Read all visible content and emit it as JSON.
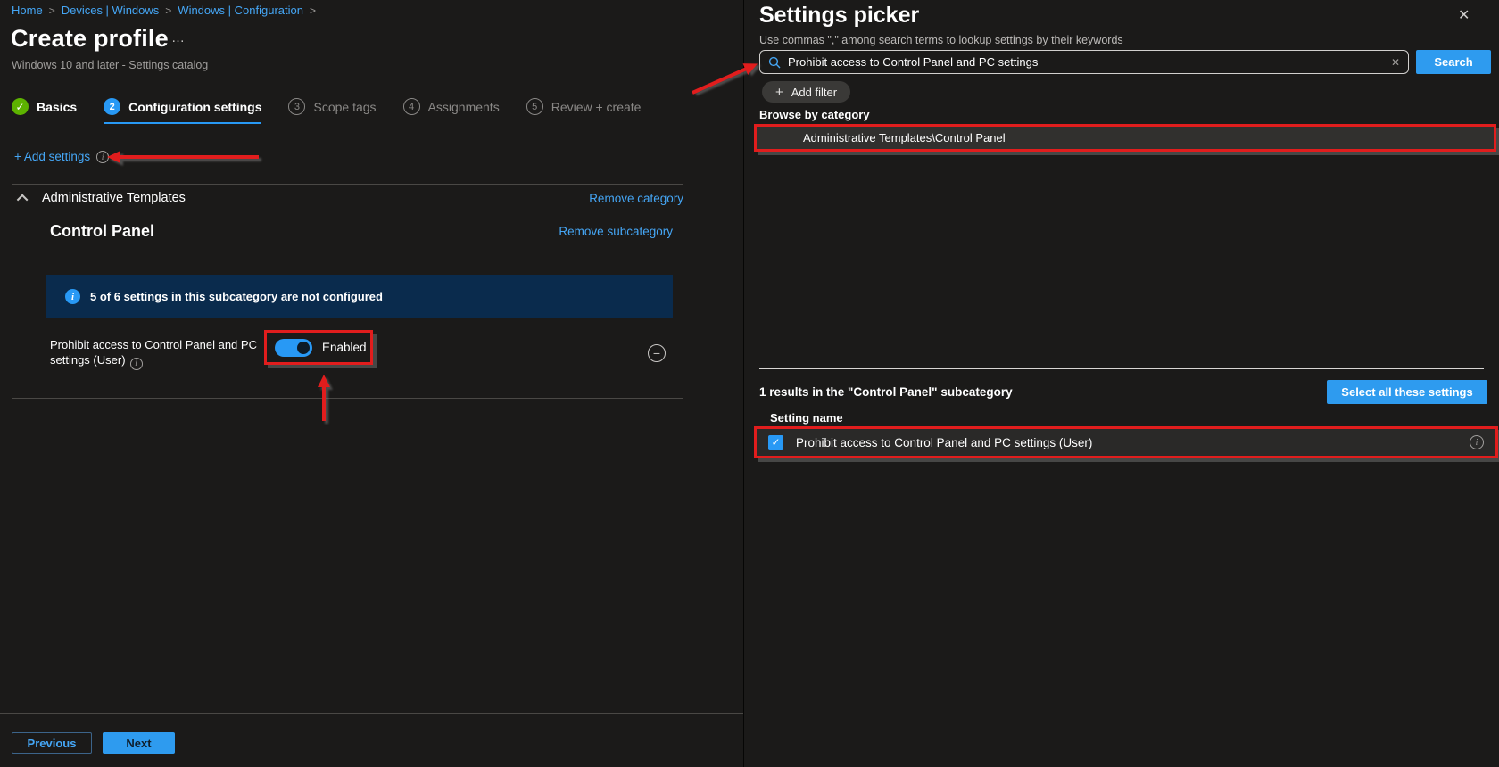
{
  "breadcrumb": {
    "separator": ">",
    "items": [
      {
        "label": "Home"
      },
      {
        "label": "Devices | Windows"
      },
      {
        "label": "Windows | Configuration"
      }
    ]
  },
  "header": {
    "title": "Create profile",
    "menu_dots": "…",
    "subtitle": "Windows 10 and later - Settings catalog"
  },
  "steps": [
    {
      "num": "✓",
      "label": "Basics"
    },
    {
      "num": "2",
      "label": "Configuration settings"
    },
    {
      "num": "3",
      "label": "Scope tags"
    },
    {
      "num": "4",
      "label": "Assignments"
    },
    {
      "num": "5",
      "label": "Review + create"
    }
  ],
  "left": {
    "add_settings_label": "+ Add settings",
    "category_name": "Administrative Templates",
    "remove_category_label": "Remove category",
    "subcategory_name": "Control Panel",
    "remove_subcategory_label": "Remove subcategory",
    "banner_text": "5 of 6 settings in this subcategory are not configured",
    "setting_label": "Prohibit access to Control Panel and PC settings (User)",
    "toggle_state": "Enabled",
    "previous_label": "Previous",
    "next_label": "Next"
  },
  "picker": {
    "title": "Settings picker",
    "subtitle": "Use commas \",\" among search terms to lookup settings by their keywords",
    "search_value": "Prohibit access to Control Panel and PC settings",
    "search_button_label": "Search",
    "add_filter_label": "Add filter",
    "browse_label": "Browse by category",
    "category_path": "Administrative Templates\\Control Panel",
    "results_text": "1 results in the \"Control Panel\" subcategory",
    "select_all_label": "Select all these settings",
    "setting_name_label": "Setting name",
    "result_label": "Prohibit access to Control Panel and PC settings (User)"
  },
  "icons": {
    "check": "✓",
    "info": "i",
    "minus": "−",
    "close": "✕",
    "clear": "✕",
    "plus": "+"
  },
  "colors": {
    "background": "#1b1a19",
    "accent_blue": "#2e9bef",
    "link_blue": "#45a6f5",
    "success_green": "#5db300",
    "banner_navy": "#0a2b4d",
    "highlight_red": "#e11d1d",
    "row_selected": "#31302e"
  }
}
